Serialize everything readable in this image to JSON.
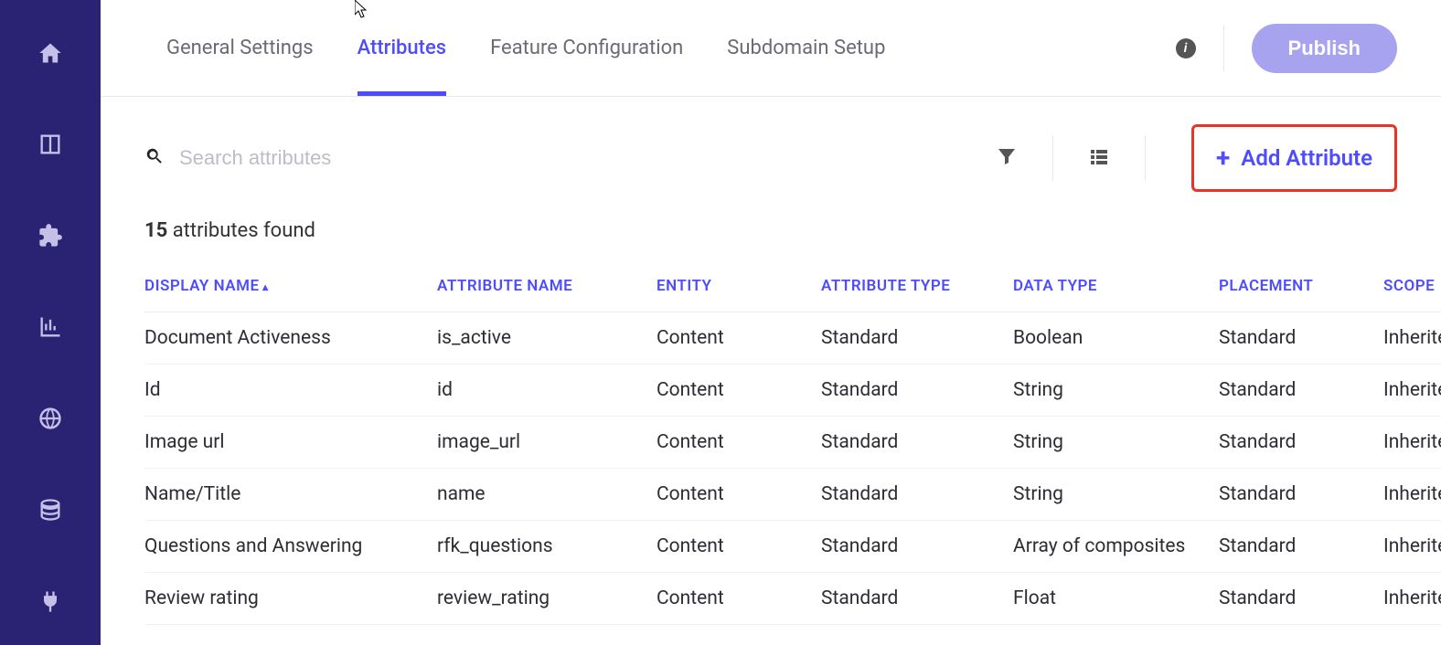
{
  "sidebar": {
    "items": [
      {
        "name": "home-icon"
      },
      {
        "name": "panel-icon"
      },
      {
        "name": "puzzle-icon"
      },
      {
        "name": "chart-icon"
      },
      {
        "name": "globe-icon"
      },
      {
        "name": "database-icon"
      },
      {
        "name": "plug-icon"
      }
    ]
  },
  "tabs": {
    "items": [
      {
        "label": "General Settings",
        "active": false
      },
      {
        "label": "Attributes",
        "active": true
      },
      {
        "label": "Feature Configuration",
        "active": false
      },
      {
        "label": "Subdomain Setup",
        "active": false
      }
    ],
    "publish_label": "Publish"
  },
  "toolbar": {
    "search_placeholder": "Search attributes",
    "add_label": "Add Attribute"
  },
  "count": {
    "number": "15",
    "suffix": " attributes found"
  },
  "table": {
    "headers": {
      "display_name": "DISPLAY NAME",
      "attribute_name": "ATTRIBUTE NAME",
      "entity": "ENTITY",
      "attribute_type": "ATTRIBUTE TYPE",
      "data_type": "DATA TYPE",
      "placement": "PLACEMENT",
      "scope": "SCOPE"
    },
    "rows": [
      {
        "display_name": "Document Activeness",
        "attribute_name": "is_active",
        "entity": "Content",
        "attribute_type": "Standard",
        "data_type": "Boolean",
        "placement": "Standard",
        "scope": "Inherite"
      },
      {
        "display_name": "Id",
        "attribute_name": "id",
        "entity": "Content",
        "attribute_type": "Standard",
        "data_type": "String",
        "placement": "Standard",
        "scope": "Inherite"
      },
      {
        "display_name": "Image url",
        "attribute_name": "image_url",
        "entity": "Content",
        "attribute_type": "Standard",
        "data_type": "String",
        "placement": "Standard",
        "scope": "Inherite"
      },
      {
        "display_name": "Name/Title",
        "attribute_name": "name",
        "entity": "Content",
        "attribute_type": "Standard",
        "data_type": "String",
        "placement": "Standard",
        "scope": "Inherite"
      },
      {
        "display_name": "Questions and Answering",
        "attribute_name": "rfk_questions",
        "entity": "Content",
        "attribute_type": "Standard",
        "data_type": "Array of composites",
        "placement": "Standard",
        "scope": "Inherite"
      },
      {
        "display_name": "Review rating",
        "attribute_name": "review_rating",
        "entity": "Content",
        "attribute_type": "Standard",
        "data_type": "Float",
        "placement": "Standard",
        "scope": "Inherite"
      }
    ]
  }
}
